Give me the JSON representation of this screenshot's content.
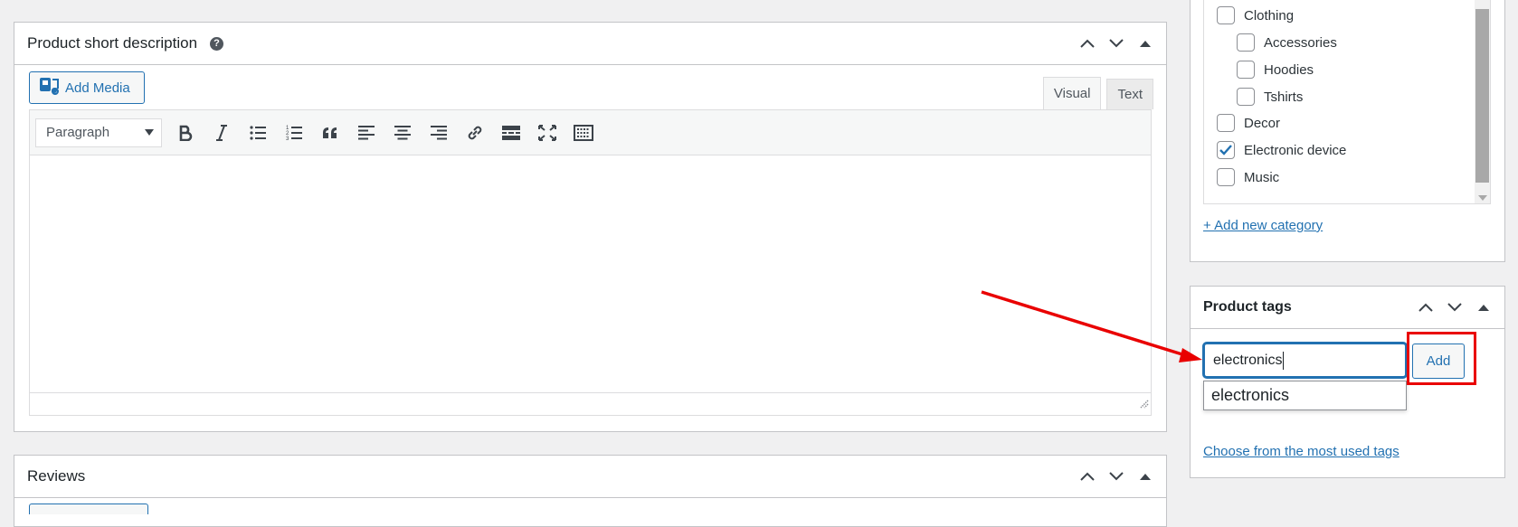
{
  "short_description": {
    "title": "Product short description",
    "help_icon": "question-icon",
    "add_media_label": "Add Media",
    "tabs": {
      "visual": "Visual",
      "text": "Text"
    },
    "format_select": "Paragraph",
    "toolbar_icons": [
      "bold-icon",
      "italic-icon",
      "bullet-list-icon",
      "numbered-list-icon",
      "blockquote-icon",
      "align-left-icon",
      "align-center-icon",
      "align-right-icon",
      "link-icon",
      "read-more-icon",
      "fullscreen-icon",
      "toolbar-toggle-icon"
    ]
  },
  "categories": {
    "items": [
      {
        "label": "Clothing",
        "checked": false,
        "level": 0
      },
      {
        "label": "Accessories",
        "checked": false,
        "level": 1
      },
      {
        "label": "Hoodies",
        "checked": false,
        "level": 1
      },
      {
        "label": "Tshirts",
        "checked": false,
        "level": 1
      },
      {
        "label": "Decor",
        "checked": false,
        "level": 0
      },
      {
        "label": "Electronic device",
        "checked": true,
        "level": 0
      },
      {
        "label": "Music",
        "checked": false,
        "level": 0
      }
    ],
    "add_link": "+ Add new category"
  },
  "product_tags": {
    "title": "Product tags",
    "input_value": "electronics",
    "add_button": "Add",
    "suggestion": "electronics",
    "most_used_link": "Choose from the most used tags"
  },
  "reviews": {
    "title": "Reviews"
  },
  "colors": {
    "accent": "#2271b1",
    "annotation": "#e90000"
  }
}
